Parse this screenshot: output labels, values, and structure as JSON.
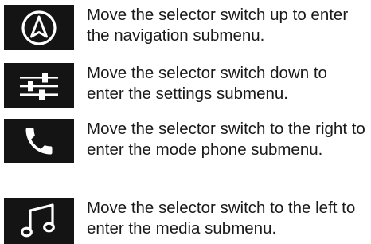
{
  "items": [
    {
      "icon": "navigation-icon",
      "text": "Move the selector switch up to enter the navigation submenu."
    },
    {
      "icon": "settings-sliders-icon",
      "text": "Move the selector switch down to enter the settings submenu."
    },
    {
      "icon": "phone-icon",
      "text": "Move the selector switch to the right to enter the mode phone submenu."
    },
    {
      "icon": "music-note-icon",
      "text": "Move the selector switch to the left to enter the media submenu."
    }
  ]
}
